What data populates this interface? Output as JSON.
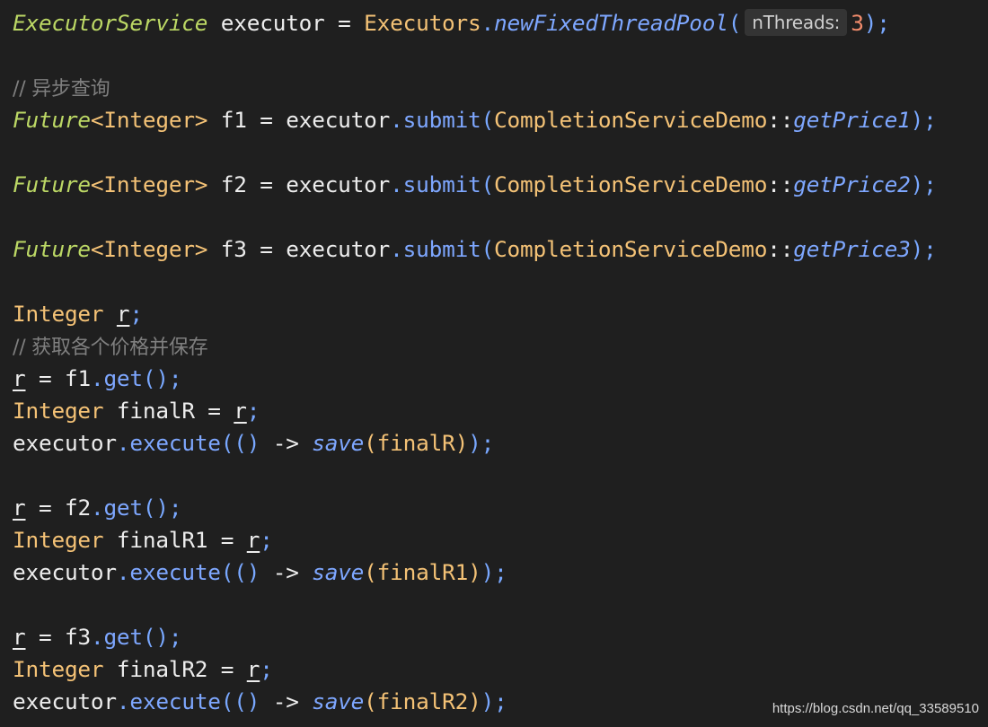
{
  "code": {
    "lines": [
      [
        {
          "t": "ExecutorService",
          "c": "t-class"
        },
        {
          "t": " executor ",
          "c": "t-var"
        },
        {
          "t": "=",
          "c": "t-op"
        },
        {
          "t": " ",
          "c": "t-var"
        },
        {
          "t": "Executors",
          "c": "t-type"
        },
        {
          "t": ".",
          "c": "t-dot"
        },
        {
          "t": "newFixedThreadPool",
          "c": "t-method-i"
        },
        {
          "t": "(",
          "c": "t-paren"
        },
        {
          "t": "nThreads:",
          "c": "hint"
        },
        {
          "t": "3",
          "c": "t-num"
        },
        {
          "t": ")",
          "c": "t-paren"
        },
        {
          "t": ";",
          "c": "t-semi"
        }
      ],
      [],
      [
        {
          "t": "// 异步查询",
          "c": "t-comment"
        }
      ],
      [
        {
          "t": "Future",
          "c": "t-class"
        },
        {
          "t": "<Integer>",
          "c": "t-type"
        },
        {
          "t": " f1 ",
          "c": "t-var"
        },
        {
          "t": "=",
          "c": "t-op"
        },
        {
          "t": " executor",
          "c": "t-var"
        },
        {
          "t": ".",
          "c": "t-dot"
        },
        {
          "t": "submit",
          "c": "t-method"
        },
        {
          "t": "(",
          "c": "t-paren"
        },
        {
          "t": "CompletionServiceDemo",
          "c": "t-type"
        },
        {
          "t": "::",
          "c": "t-var"
        },
        {
          "t": "getPrice1",
          "c": "t-method-i"
        },
        {
          "t": ")",
          "c": "t-paren"
        },
        {
          "t": ";",
          "c": "t-semi"
        }
      ],
      [],
      [
        {
          "t": "Future",
          "c": "t-class"
        },
        {
          "t": "<Integer>",
          "c": "t-type"
        },
        {
          "t": " f2 ",
          "c": "t-var"
        },
        {
          "t": "=",
          "c": "t-op"
        },
        {
          "t": " executor",
          "c": "t-var"
        },
        {
          "t": ".",
          "c": "t-dot"
        },
        {
          "t": "submit",
          "c": "t-method"
        },
        {
          "t": "(",
          "c": "t-paren"
        },
        {
          "t": "CompletionServiceDemo",
          "c": "t-type"
        },
        {
          "t": "::",
          "c": "t-var"
        },
        {
          "t": "getPrice2",
          "c": "t-method-i"
        },
        {
          "t": ")",
          "c": "t-paren"
        },
        {
          "t": ";",
          "c": "t-semi"
        }
      ],
      [],
      [
        {
          "t": "Future",
          "c": "t-class"
        },
        {
          "t": "<Integer>",
          "c": "t-type"
        },
        {
          "t": " f3 ",
          "c": "t-var"
        },
        {
          "t": "=",
          "c": "t-op"
        },
        {
          "t": " executor",
          "c": "t-var"
        },
        {
          "t": ".",
          "c": "t-dot"
        },
        {
          "t": "submit",
          "c": "t-method"
        },
        {
          "t": "(",
          "c": "t-paren"
        },
        {
          "t": "CompletionServiceDemo",
          "c": "t-type"
        },
        {
          "t": "::",
          "c": "t-var"
        },
        {
          "t": "getPrice3",
          "c": "t-method-i"
        },
        {
          "t": ")",
          "c": "t-paren"
        },
        {
          "t": ";",
          "c": "t-semi"
        }
      ],
      [],
      [
        {
          "t": "Integer",
          "c": "t-type"
        },
        {
          "t": " ",
          "c": "t-var"
        },
        {
          "t": "r",
          "c": "t-var t-ul"
        },
        {
          "t": ";",
          "c": "t-semi"
        }
      ],
      [
        {
          "t": "// 获取各个价格并保存",
          "c": "t-comment"
        }
      ],
      [
        {
          "t": "r",
          "c": "t-var t-ul"
        },
        {
          "t": " = f1",
          "c": "t-var"
        },
        {
          "t": ".",
          "c": "t-dot"
        },
        {
          "t": "get",
          "c": "t-method"
        },
        {
          "t": "()",
          "c": "t-paren"
        },
        {
          "t": ";",
          "c": "t-semi"
        }
      ],
      [
        {
          "t": "Integer",
          "c": "t-type"
        },
        {
          "t": " finalR = ",
          "c": "t-var"
        },
        {
          "t": "r",
          "c": "t-var t-ul"
        },
        {
          "t": ";",
          "c": "t-semi"
        }
      ],
      [
        {
          "t": "executor",
          "c": "t-var"
        },
        {
          "t": ".",
          "c": "t-dot"
        },
        {
          "t": "execute",
          "c": "t-method"
        },
        {
          "t": "(()",
          "c": "t-paren"
        },
        {
          "t": " -> ",
          "c": "t-var"
        },
        {
          "t": "save",
          "c": "t-method-i"
        },
        {
          "t": "(",
          "c": "t-paren2"
        },
        {
          "t": "finalR",
          "c": "t-type"
        },
        {
          "t": ")",
          "c": "t-paren2"
        },
        {
          "t": ")",
          "c": "t-paren"
        },
        {
          "t": ";",
          "c": "t-semi"
        }
      ],
      [],
      [
        {
          "t": "r",
          "c": "t-var t-ul"
        },
        {
          "t": " = f2",
          "c": "t-var"
        },
        {
          "t": ".",
          "c": "t-dot"
        },
        {
          "t": "get",
          "c": "t-method"
        },
        {
          "t": "()",
          "c": "t-paren"
        },
        {
          "t": ";",
          "c": "t-semi"
        }
      ],
      [
        {
          "t": "Integer",
          "c": "t-type"
        },
        {
          "t": " finalR1 = ",
          "c": "t-var"
        },
        {
          "t": "r",
          "c": "t-var t-ul"
        },
        {
          "t": ";",
          "c": "t-semi"
        }
      ],
      [
        {
          "t": "executor",
          "c": "t-var"
        },
        {
          "t": ".",
          "c": "t-dot"
        },
        {
          "t": "execute",
          "c": "t-method"
        },
        {
          "t": "(()",
          "c": "t-paren"
        },
        {
          "t": " -> ",
          "c": "t-var"
        },
        {
          "t": "save",
          "c": "t-method-i"
        },
        {
          "t": "(",
          "c": "t-paren2"
        },
        {
          "t": "finalR1",
          "c": "t-type"
        },
        {
          "t": ")",
          "c": "t-paren2"
        },
        {
          "t": ")",
          "c": "t-paren"
        },
        {
          "t": ";",
          "c": "t-semi"
        }
      ],
      [],
      [
        {
          "t": "r",
          "c": "t-var t-ul"
        },
        {
          "t": " = f3",
          "c": "t-var"
        },
        {
          "t": ".",
          "c": "t-dot"
        },
        {
          "t": "get",
          "c": "t-method"
        },
        {
          "t": "()",
          "c": "t-paren"
        },
        {
          "t": ";",
          "c": "t-semi"
        }
      ],
      [
        {
          "t": "Integer",
          "c": "t-type"
        },
        {
          "t": " finalR2 = ",
          "c": "t-var"
        },
        {
          "t": "r",
          "c": "t-var t-ul"
        },
        {
          "t": ";",
          "c": "t-semi"
        }
      ],
      [
        {
          "t": "executor",
          "c": "t-var"
        },
        {
          "t": ".",
          "c": "t-dot"
        },
        {
          "t": "execute",
          "c": "t-method"
        },
        {
          "t": "(()",
          "c": "t-paren"
        },
        {
          "t": " -> ",
          "c": "t-var"
        },
        {
          "t": "save",
          "c": "t-method-i"
        },
        {
          "t": "(",
          "c": "t-paren2"
        },
        {
          "t": "finalR2",
          "c": "t-type"
        },
        {
          "t": ")",
          "c": "t-paren2"
        },
        {
          "t": ")",
          "c": "t-paren"
        },
        {
          "t": ";",
          "c": "t-semi"
        }
      ]
    ]
  },
  "watermark": "https://blog.csdn.net/qq_33589510"
}
